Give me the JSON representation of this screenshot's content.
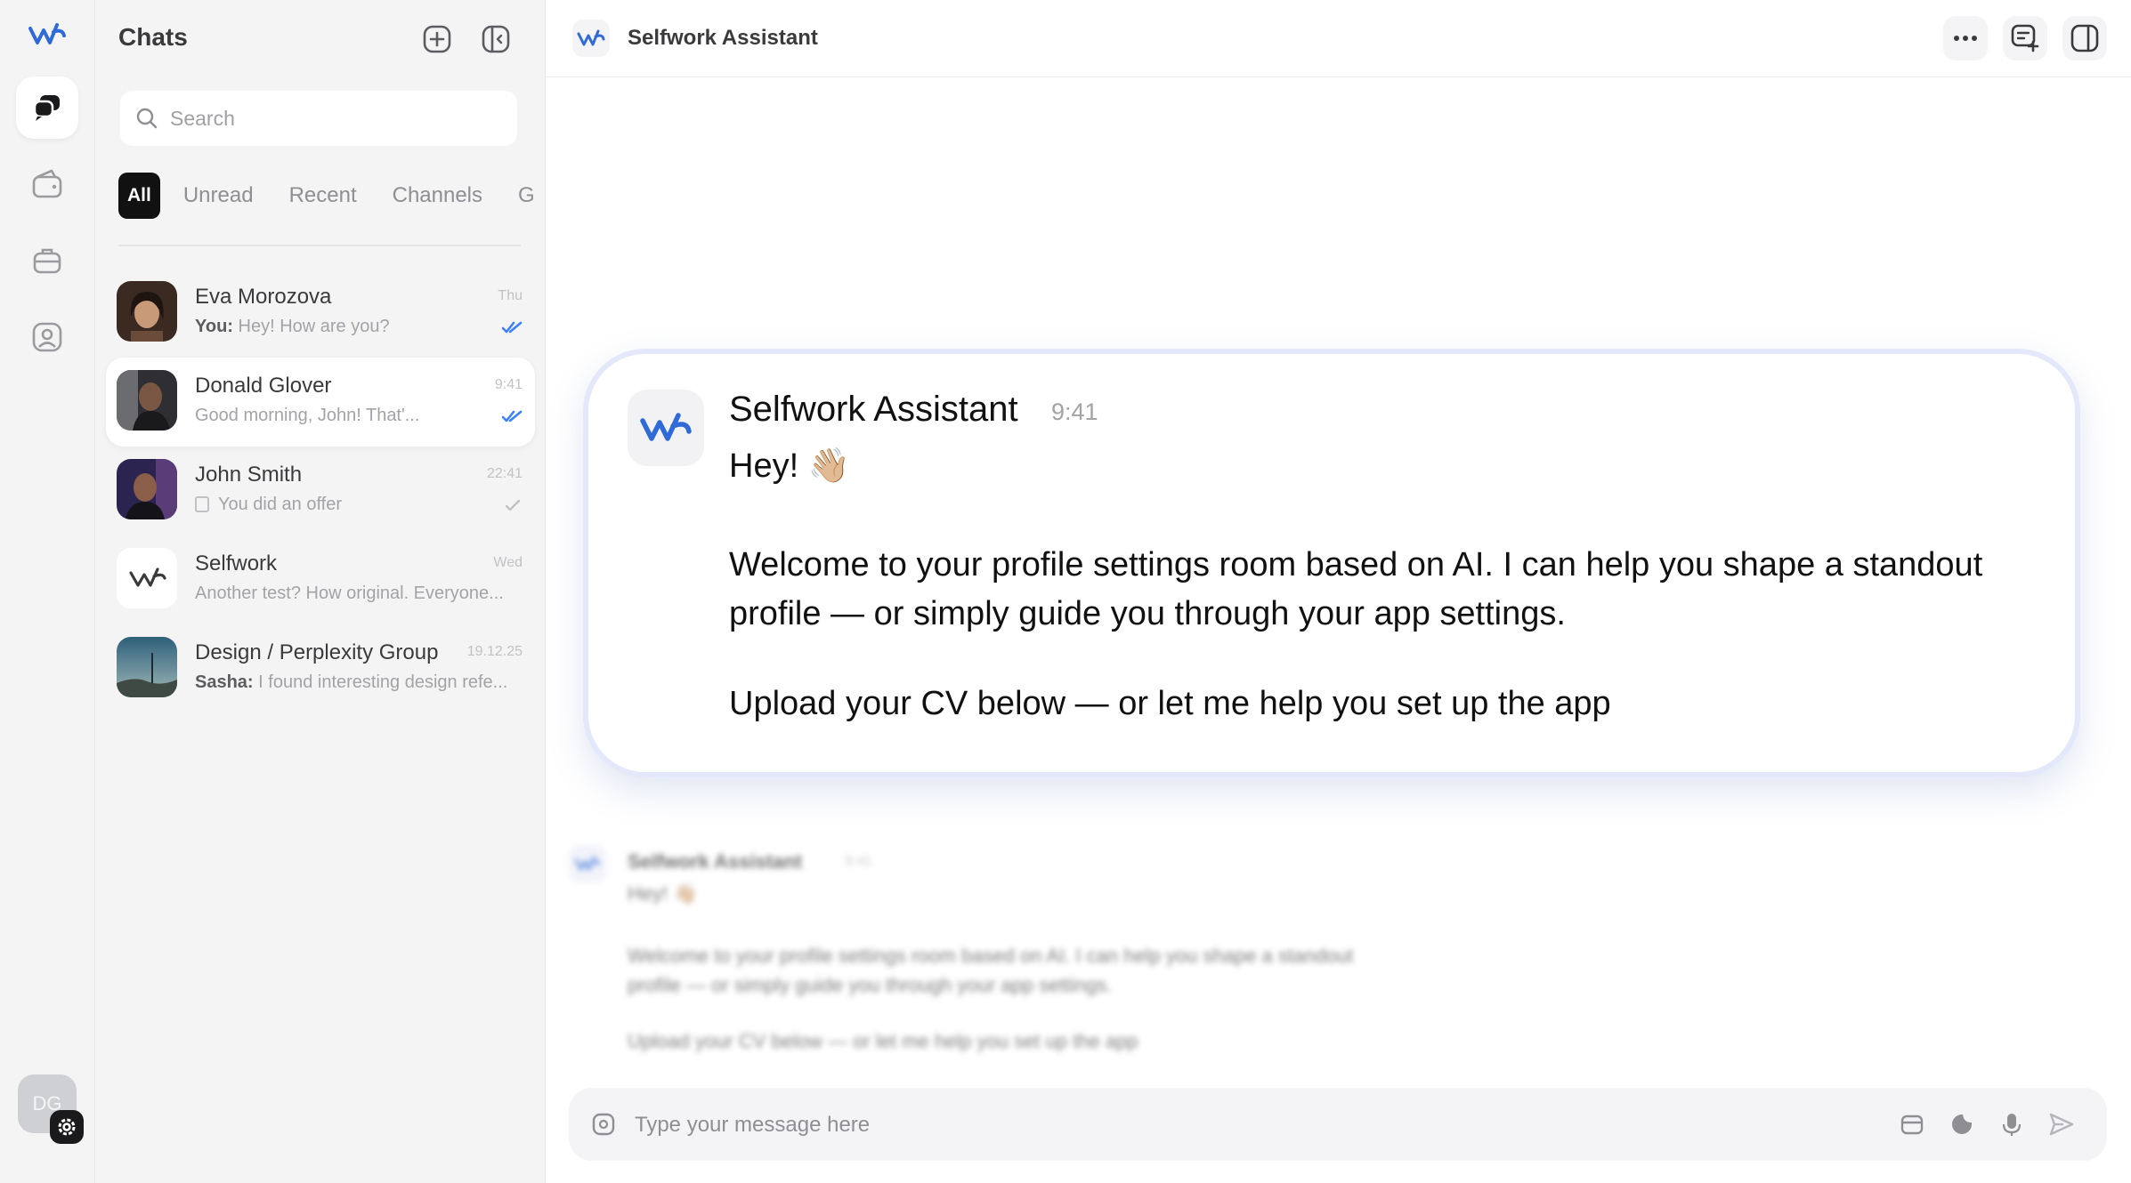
{
  "colors": {
    "accent": "#2f6ad9",
    "check": "#3b82f6",
    "card_border": "#e3e9fa"
  },
  "rail": {
    "items": [
      {
        "icon": "chats-icon",
        "active": true
      },
      {
        "icon": "wallet-icon",
        "active": false
      },
      {
        "icon": "briefcase-icon",
        "active": false
      },
      {
        "icon": "profile-icon",
        "active": false
      }
    ],
    "avatar_initials": "DG"
  },
  "chat_list": {
    "title": "Chats",
    "search_placeholder": "Search",
    "filters": [
      "All",
      "Unread",
      "Recent",
      "Channels",
      "G"
    ],
    "chats": [
      {
        "name": "Eva Morozova",
        "sender": "You:",
        "preview": "Hey! How are you?",
        "time": "Thu",
        "read": true
      },
      {
        "name": "Donald Glover",
        "sender": "",
        "preview": "Good morning, John! That'...",
        "time": "9:41",
        "read": true
      },
      {
        "name": "John Smith",
        "sender": "",
        "preview": "You did an offer",
        "time": "22:41",
        "read": false
      },
      {
        "name": "Selfwork",
        "sender": "",
        "preview": "Another test? How original. Everyone...",
        "time": "Wed",
        "read": false
      },
      {
        "name": "Design / Perplexity Group",
        "sender": "Sasha:",
        "preview": "I found interesting design refe...",
        "time": "19.12.25",
        "read": false
      }
    ]
  },
  "main": {
    "header_title": "Selfwork Assistant",
    "message": {
      "sender": "Selfwork Assistant",
      "time": "9:41",
      "greeting": "Hey! 👋🏼",
      "paragraph": "Welcome to your profile settings room based on AI. I can help you shape a standout profile — or simply guide you through your app settings.",
      "cta": "Upload your CV below — or let me help you set up the app"
    },
    "composer_placeholder": "Type your message here"
  }
}
